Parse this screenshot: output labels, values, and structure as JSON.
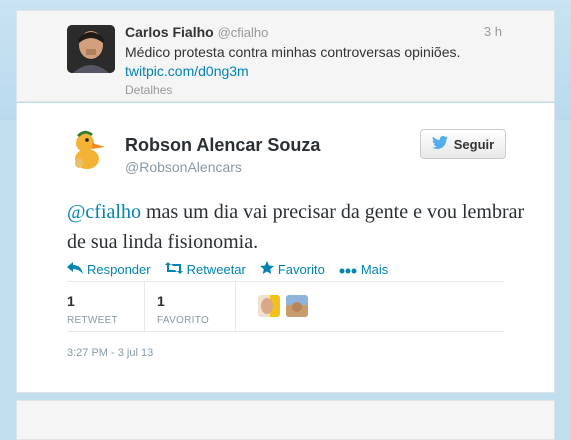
{
  "parent_tweet": {
    "name": "Carlos Fialho",
    "handle": "@cfialho",
    "time": "3 h",
    "text": "Médico protesta contra minhas controversas opiniões.",
    "link": "twitpic.com/d0ng3m",
    "details_label": "Detalhes"
  },
  "main_tweet": {
    "name": "Robson Alencar Souza",
    "handle": "@RobsonAlencars",
    "follow_label": "Seguir",
    "mention": "@cfialho",
    "text_rest": " mas um dia vai precisar da gente e vou lembrar de sua linda fisionomia.",
    "actions": {
      "reply": "Responder",
      "retweet": "Retweetar",
      "favorite": "Favorito",
      "more": "Mais"
    },
    "stats": {
      "retweets_count": "1",
      "retweets_label": "RETWEET",
      "favorites_count": "1",
      "favorites_label": "FAVORITO"
    },
    "timestamp": "3:27 PM - 3 jul 13"
  },
  "colors": {
    "link": "#0084b4",
    "background": "#c0deed",
    "muted": "#8899a6"
  },
  "icons": [
    "twitter-bird-icon",
    "reply-icon",
    "retweet-icon",
    "star-icon",
    "more-dots-icon"
  ]
}
